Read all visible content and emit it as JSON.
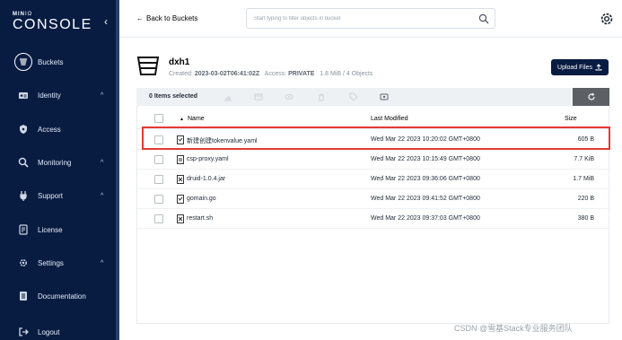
{
  "logo": {
    "min": "MIN",
    "io": "IO",
    "console": "CONSOLE"
  },
  "sidebar": {
    "items": [
      {
        "label": "Buckets",
        "icon": "bucket-icon",
        "active": true
      },
      {
        "label": "Identity",
        "icon": "identity-icon",
        "chevron": "^"
      },
      {
        "label": "Access",
        "icon": "access-icon"
      },
      {
        "label": "Monitoring",
        "icon": "monitoring-icon",
        "chevron": "^"
      },
      {
        "label": "Support",
        "icon": "support-icon",
        "chevron": "^"
      },
      {
        "label": "License",
        "icon": "license-icon"
      },
      {
        "label": "Settings",
        "icon": "settings-icon",
        "chevron": "^"
      },
      {
        "label": "Documentation",
        "icon": "documentation-icon"
      },
      {
        "label": "Logout",
        "icon": "logout-icon"
      }
    ],
    "collapse_glyph": "‹"
  },
  "topbar": {
    "back_label": "Back to Buckets",
    "search_placeholder": "Start typing to filter objects in bucket"
  },
  "bucket": {
    "name": "dxh1",
    "created_label": "Created:",
    "created_value": "2023-03-02T06:41:02Z",
    "access_label": "Access:",
    "access_value": "PRIVATE",
    "usage": "1.8 MiB / 4 Objects",
    "upload_label": "Upload Files"
  },
  "toolbar": {
    "selected_count": "0 Items selected"
  },
  "table": {
    "columns": {
      "name": "Name",
      "sort_glyph": "▲",
      "modified": "Last Modified",
      "size": "Size"
    },
    "rows": [
      {
        "name": "新建创建tokenvalue.yaml",
        "modified": "Wed Mar 22 2023 10:20:02 GMT+0800",
        "size": "605 B"
      },
      {
        "name": "csp-proxy.yaml",
        "modified": "Wed Mar 22 2023 10:15:49 GMT+0800",
        "size": "7.7 KiB"
      },
      {
        "name": "druid-1.0.4.jar",
        "modified": "Wed Mar 22 2023 09:36:06 GMT+0800",
        "size": "1.7 MiB"
      },
      {
        "name": "gomain.go",
        "modified": "Wed Mar 22 2023 09:41:52 GMT+0800",
        "size": "220 B"
      },
      {
        "name": "restart.sh",
        "modified": "Wed Mar 22 2023 09:37:03 GMT+0800",
        "size": "380 B"
      }
    ]
  },
  "watermark": "CSDN @雪基Stack专业服务团队",
  "colors": {
    "sidebar": "#081c42",
    "highlight": "#e53935",
    "refresh": "#5c5f63"
  }
}
